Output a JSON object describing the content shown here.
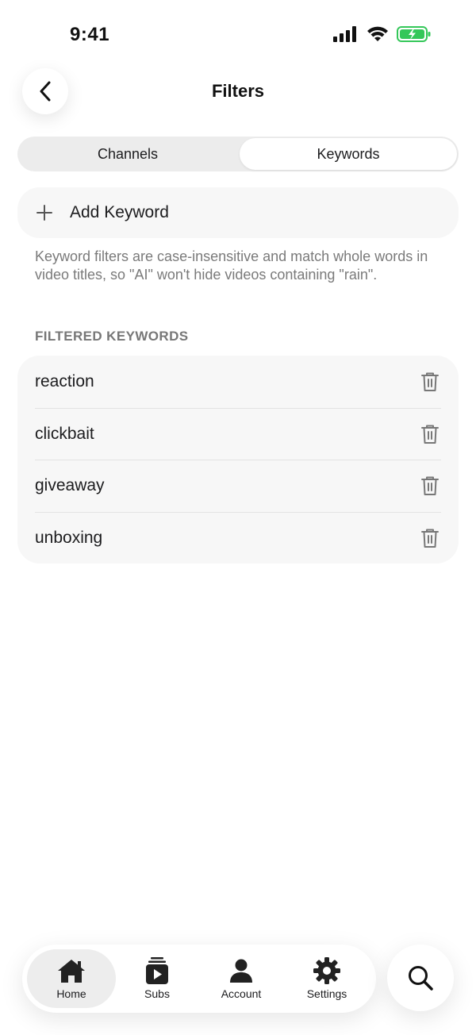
{
  "status_bar": {
    "time": "9:41"
  },
  "header": {
    "title": "Filters"
  },
  "segmented": {
    "tabs": [
      {
        "label": "Channels"
      },
      {
        "label": "Keywords"
      }
    ],
    "selected": "Keywords"
  },
  "add_keyword": {
    "label": "Add Keyword"
  },
  "help_text": "Keyword filters are case-insensitive and match whole words in video titles, so \"AI\" won't hide videos containing \"rain\".",
  "section": {
    "title": "FILTERED KEYWORDS"
  },
  "keywords": [
    {
      "text": "reaction"
    },
    {
      "text": "clickbait"
    },
    {
      "text": "giveaway"
    },
    {
      "text": "unboxing"
    }
  ],
  "tabbar": {
    "items": [
      {
        "label": "Home",
        "icon": "house-icon",
        "active": true
      },
      {
        "label": "Subs",
        "icon": "subscriptions-icon",
        "active": false
      },
      {
        "label": "Account",
        "icon": "person-icon",
        "active": false
      },
      {
        "label": "Settings",
        "icon": "gear-icon",
        "active": false
      }
    ]
  },
  "search": {
    "icon": "magnifier-icon"
  },
  "colors": {
    "battery_green": "#34c759",
    "text": "#1c1c1e",
    "muted": "#7a7a7a"
  }
}
